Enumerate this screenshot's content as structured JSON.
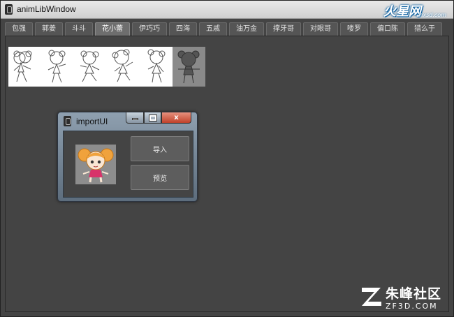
{
  "window": {
    "title": "animLibWindow"
  },
  "brand": {
    "logo": "火星网",
    "url": "hxsd.com"
  },
  "tabs": [
    {
      "label": "包强",
      "active": false
    },
    {
      "label": "郭姜",
      "active": false
    },
    {
      "label": "斗斗",
      "active": false
    },
    {
      "label": "花小蕾",
      "active": true
    },
    {
      "label": "伊巧巧",
      "active": false
    },
    {
      "label": "四海",
      "active": false
    },
    {
      "label": "五戚",
      "active": false
    },
    {
      "label": "油万金",
      "active": false
    },
    {
      "label": "撑牙哥",
      "active": false
    },
    {
      "label": "对眼哥",
      "active": false
    },
    {
      "label": "喽罗",
      "active": false
    },
    {
      "label": "偏口陈",
      "active": false
    },
    {
      "label": "猎么于",
      "active": false
    }
  ],
  "thumbnails": [
    {
      "name": "pose-1",
      "selected": false
    },
    {
      "name": "pose-2",
      "selected": false
    },
    {
      "name": "pose-3",
      "selected": false
    },
    {
      "name": "pose-4",
      "selected": false
    },
    {
      "name": "pose-5",
      "selected": false
    },
    {
      "name": "pose-6",
      "selected": true
    }
  ],
  "dialog": {
    "title": "importUI",
    "import_label": "导入",
    "preview_label": "预览",
    "close_glyph": "x"
  },
  "watermark": {
    "cn": "朱峰社区",
    "url": "ZF3D.COM"
  },
  "colors": {
    "window_bg": "#444444",
    "dialog_frame": "#7a8b9c",
    "close_red": "#c0412a",
    "brand_blue": "#0a5fa0"
  }
}
